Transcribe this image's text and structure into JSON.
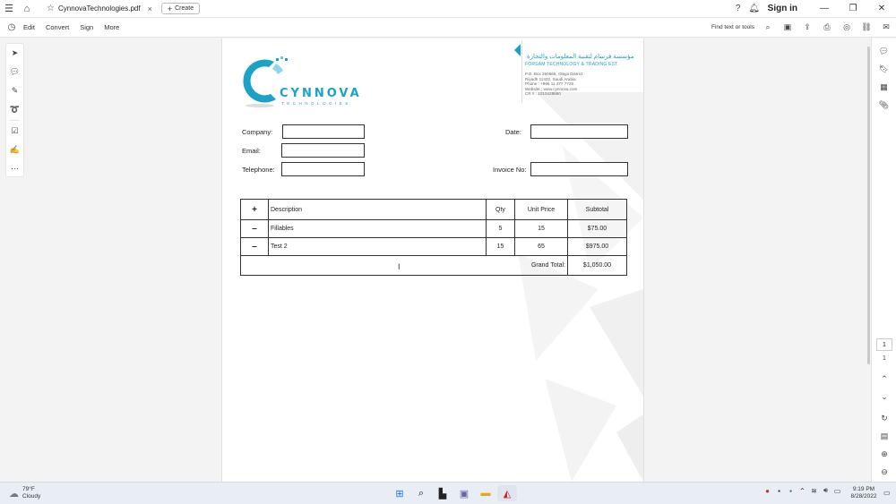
{
  "titlebar": {
    "tab_title": "CynnovaTechnologies.pdf",
    "create_label": "Create",
    "signin_label": "Sign in"
  },
  "menubar": {
    "items": [
      "Edit",
      "Convert",
      "Sign",
      "More"
    ],
    "find_label": "Find text or tools"
  },
  "document": {
    "logo_name": "CYNNOVA",
    "logo_tagline": "TECHNOLOGIES",
    "company_arabic": "مؤسسة فرسام لتقنية المعلومات والتجارة",
    "company_english": "FORSAM TECHNOLOGY & TRADING EST.",
    "address_lines": [
      "P.O. Box 260666, Olaya District",
      "Riyadh 11432, Saudi Arabia",
      "Phone    :  +966 11 477 7729",
      "Website  :  www.cynnova.com",
      "CR #     :  1010428860"
    ],
    "labels": {
      "company": "Company:",
      "email": "Email:",
      "telephone": "Telephone:",
      "date": "Date:",
      "invoice_no": "Invoice No:"
    },
    "table": {
      "add_symbol": "+",
      "remove_symbol": "–",
      "headers": {
        "description": "Description",
        "qty": "Qty",
        "unit_price": "Unit Price",
        "subtotal": "Subtotal"
      },
      "rows": [
        {
          "description": "Fillables",
          "qty": "5",
          "unit_price": "15",
          "subtotal": "$75.00"
        },
        {
          "description": "Test 2",
          "qty": "15",
          "unit_price": "65",
          "subtotal": "$975.00"
        }
      ],
      "grand_total_label": "Grand Total:",
      "grand_total_value": "$1,050.00"
    }
  },
  "pagenav": {
    "current_page": "1",
    "total_pages": "1"
  },
  "taskbar": {
    "weather_temp": "79°F",
    "weather_desc": "Cloudy",
    "time": "9:19 PM",
    "date": "8/28/2022"
  },
  "colors": {
    "brand": "#1aa3c6",
    "acrobat_red": "#d11f26"
  }
}
